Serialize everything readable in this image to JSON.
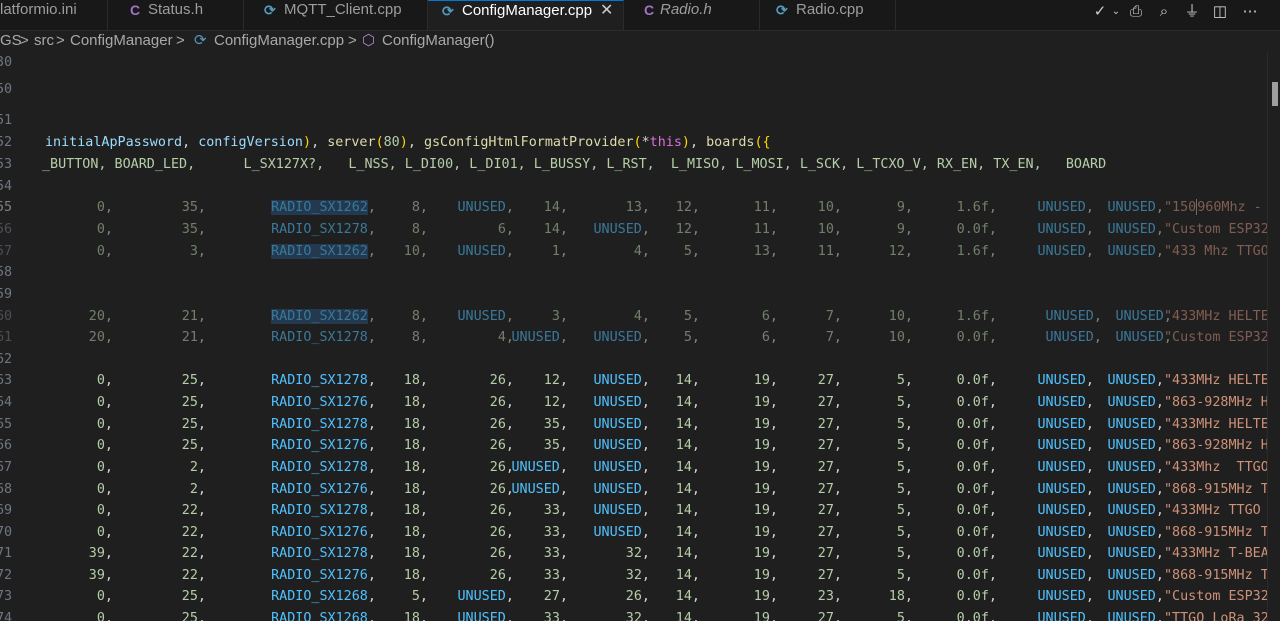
{
  "tabs": [
    {
      "icon": "",
      "label": "latformio.ini",
      "active": false,
      "italic": false
    },
    {
      "icon": "C",
      "label": "Status.h",
      "active": false,
      "italic": false
    },
    {
      "icon": "G",
      "label": "MQTT_Client.cpp",
      "active": false,
      "italic": false
    },
    {
      "icon": "G",
      "label": "ConfigManager.cpp",
      "active": true,
      "italic": false,
      "close": "✕"
    },
    {
      "icon": "C",
      "label": "Radio.h",
      "active": false,
      "italic": true
    },
    {
      "icon": "G",
      "label": "Radio.cpp",
      "active": false,
      "italic": false
    }
  ],
  "breadcrumb": {
    "root": "GS",
    "sep": ">",
    "folder": "src",
    "folder2": "ConfigManager",
    "file": "ConfigManager.cpp",
    "symbol": "ConfigManager()"
  },
  "editor": {
    "sticky_line_number": "30",
    "cursor_line_number": "55"
  },
  "colors": {
    "accent": "#0078d4",
    "background": "#1f1f1f",
    "macro": "#4fc1ff",
    "string": "#ce9178",
    "number": "#b5cea8"
  }
}
